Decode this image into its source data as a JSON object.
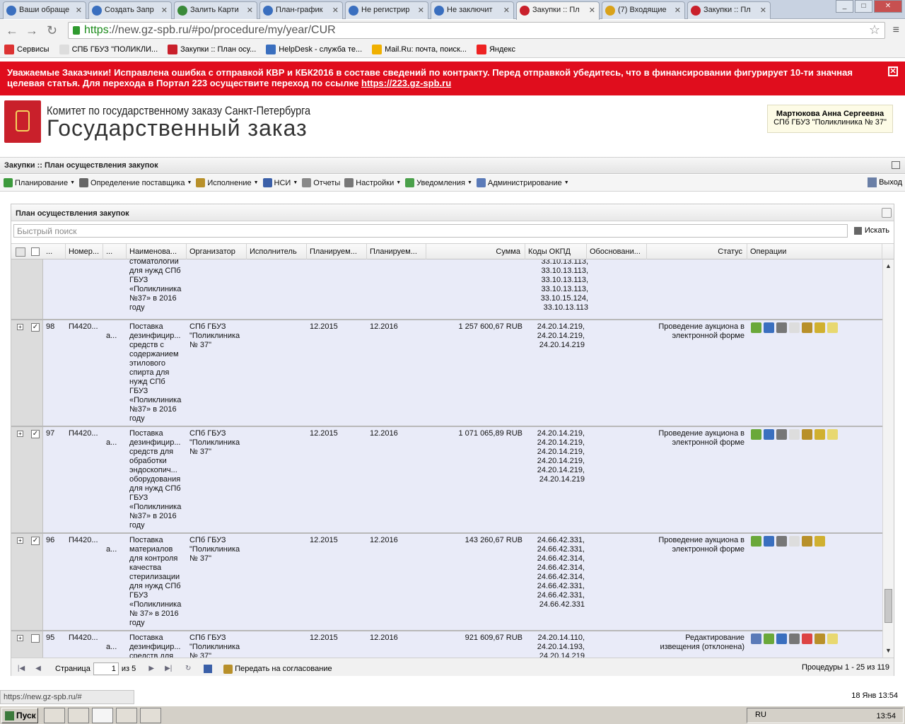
{
  "browser": {
    "tabs": [
      {
        "label": "Ваши обраще",
        "color": "#3a6fbf"
      },
      {
        "label": "Создать Запр",
        "color": "#3a6fbf"
      },
      {
        "label": "Залить Карти",
        "color": "#3a8a3a"
      },
      {
        "label": "План-график",
        "color": "#3a6fbf"
      },
      {
        "label": "Не регистрир",
        "color": "#3a6fbf"
      },
      {
        "label": "Не заключит",
        "color": "#3a6fbf"
      },
      {
        "label": "Закупки :: Пл",
        "color": "#c9202b"
      },
      {
        "label": "(7) Входящие",
        "color": "#d9a21a"
      },
      {
        "label": "Закупки :: Пл",
        "color": "#c9202b"
      }
    ],
    "url_scheme": "https",
    "url_rest": "://new.gz-spb.ru/#po/procedure/my/year/CUR",
    "bookmarks": [
      {
        "label": "Сервисы",
        "color": "#d33"
      },
      {
        "label": "СПБ ГБУЗ \"ПОЛИКЛИ...",
        "color": "#ddd"
      },
      {
        "label": "Закупки :: План осу...",
        "color": "#c9202b"
      },
      {
        "label": "HelpDesk - служба те...",
        "color": "#3a6fbf"
      },
      {
        "label": "Mail.Ru: почта, поиск...",
        "color": "#f0b000"
      },
      {
        "label": "Яндекс",
        "color": "#e22"
      }
    ]
  },
  "banner": {
    "text": "Уважаемые Заказчики! Исправлена ошибка с отправкой КВР и КБК2016 в составе сведений по контракту. Перед отправкой убедитесь, что в финансировании фигурирует 10-ти значная целевая статья. Для перехода в Портал 223 осуществите переход по ссылке ",
    "link": "https://223.gz-spb.ru"
  },
  "header": {
    "org_line": "Комитет по государственному заказу Санкт-Петербурга",
    "title": "Государственный заказ",
    "user_name": "Мартюкова Анна Сергеевна",
    "user_org": "СПб ГБУЗ \"Поликлиника № 37\""
  },
  "page_title": "Закупки :: План осуществления закупок",
  "menu": [
    {
      "label": "Планирование",
      "dropdown": true,
      "color": "#3c9a3c"
    },
    {
      "label": "Определение поставщика",
      "dropdown": true,
      "color": "#666"
    },
    {
      "label": "Исполнение",
      "dropdown": true,
      "color": "#b8902a"
    },
    {
      "label": "НСИ",
      "dropdown": true,
      "color": "#3a5fa8"
    },
    {
      "label": "Отчеты",
      "dropdown": false,
      "color": "#888"
    },
    {
      "label": "Настройки",
      "dropdown": true,
      "color": "#777"
    },
    {
      "label": "Уведомления",
      "dropdown": true,
      "color": "#4aa04a"
    },
    {
      "label": "Администрирование",
      "dropdown": true,
      "color": "#5a7ab8"
    }
  ],
  "exit_label": "Выход",
  "grid": {
    "title": "План осуществления закупок",
    "search_placeholder": "Быстрый поиск",
    "search_button": "Искать",
    "columns": [
      "...",
      "Номер...",
      "...",
      "Наименова...",
      "Организатор",
      "Исполнитель",
      "Планируем...",
      "Планируем...",
      "Сумма",
      "Коды ОКПД",
      "Обосновани...",
      "Статус",
      "Операции"
    ],
    "partial_row": {
      "name": "стоматологии\nдля нужд СПб\nГБУЗ\n«Поликлиника\n№37» в 2016\nгоду",
      "okpd": "33.10.13.113,\n33.10.13.113,\n33.10.13.113,\n33.10.13.113,\n33.10.15.124,\n33.10.13.113"
    },
    "rows": [
      {
        "num": "98",
        "number": "П4420...",
        "sub": "а...",
        "name": "Поставка\nдезинфицир...\nсредств с\nсодержанием\nэтилового\nспирта для\nнужд СПб\nГБУЗ\n«Поликлиника\n№37» в 2016\nгоду",
        "org": "СПб ГБУЗ\n\"Поликлиника\n№ 37\"",
        "plan1": "12.2015",
        "plan2": "12.2016",
        "sum": "1 257 600,67 RUB",
        "okpd": "24.20.14.219,\n24.20.14.219,\n24.20.14.219",
        "status": "Проведение аукциона в\nэлектронной форме",
        "checked": true
      },
      {
        "num": "97",
        "number": "П4420...",
        "sub": "а...",
        "name": "Поставка\nдезинфицир...\nсредств для\nобработки\nэндоскопич...\nоборудования\nдля нужд СПб\nГБУЗ\n«Поликлиника\n№37» в 2016\nгоду",
        "org": "СПб ГБУЗ\n\"Поликлиника\n№ 37\"",
        "plan1": "12.2015",
        "plan2": "12.2016",
        "sum": "1 071 065,89 RUB",
        "okpd": "24.20.14.219,\n24.20.14.219,\n24.20.14.219,\n24.20.14.219,\n24.20.14.219,\n24.20.14.219",
        "status": "Проведение аукциона в\nэлектронной форме",
        "checked": true
      },
      {
        "num": "96",
        "number": "П4420...",
        "sub": "а...",
        "name": "Поставка\nматериалов\nдля контроля\nкачества\nстерилизации\nдля нужд СПб\nГБУЗ\n«Поликлиника\n№ 37» в 2016\nгоду",
        "org": "СПб ГБУЗ\n\"Поликлиника\n№ 37\"",
        "plan1": "12.2015",
        "plan2": "12.2016",
        "sum": "143 260,67 RUB",
        "okpd": "24.66.42.331,\n24.66.42.331,\n24.66.42.314,\n24.66.42.314,\n24.66.42.314,\n24.66.42.331,\n24.66.42.331,\n24.66.42.331",
        "status": "Проведение аукциона в\nэлектронной форме",
        "checked": true
      },
      {
        "num": "95",
        "number": "П4420...",
        "sub": "а...",
        "name": "Поставка\nдезинфицир...\nсредств для",
        "org": "СПб ГБУЗ\n\"Поликлиника\n№ 37\"",
        "plan1": "12.2015",
        "plan2": "12.2016",
        "sum": "921 609,67 RUB",
        "okpd": "24.20.14.110,\n24.20.14.193,\n24.20.14.219",
        "status": "Редактирование\nизвещения (отклонена)",
        "checked": false
      }
    ],
    "op_colors_auction": [
      "#6aa83a",
      "#3a6fbf",
      "#777",
      "#ddd",
      "#b8902a",
      "#d0b030",
      "#e8d870"
    ],
    "op_colors_edit": [
      "#5a7ab8",
      "#6aa83a",
      "#3a6fbf",
      "#777",
      "#d44",
      "#b8902a",
      "#e8d870"
    ],
    "pager": {
      "page_label": "Страница",
      "page": "1",
      "of": "из 5",
      "send_label": "Передать на согласование",
      "summary": "Процедуры 1 - 25 из 119"
    }
  },
  "statusbar": {
    "url": "https://new.gz-spb.ru/#",
    "datetime": "18 Янв 13:54"
  },
  "taskbar": {
    "start": "Пуск",
    "lang": "RU",
    "clock": "13:54"
  }
}
